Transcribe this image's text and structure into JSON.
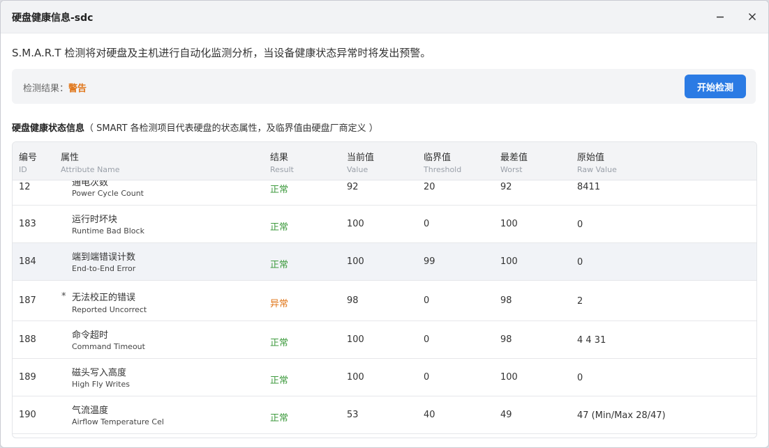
{
  "window": {
    "title": "硬盘健康信息-sdc"
  },
  "intro": "S.M.A.R.T 检测将对硬盘及主机进行自动化监测分析，当设备健康状态异常时将发出预警。",
  "result": {
    "label": "检测结果：",
    "value": "警告",
    "value_color": "#e0761a",
    "button_label": "开始检测",
    "button_color": "#2b7be4"
  },
  "section": {
    "title": "硬盘健康状态信息",
    "note": "（ SMART 各检测项目代表硬盘的状态属性，及临界值由硬盘厂商定义 ）"
  },
  "columns": [
    {
      "zh": "编号",
      "en": "ID"
    },
    {
      "zh": "属性",
      "en": "Attribute Name"
    },
    {
      "zh": "结果",
      "en": "Result"
    },
    {
      "zh": "当前值",
      "en": "Value"
    },
    {
      "zh": "临界值",
      "en": "Threshold"
    },
    {
      "zh": "最差值",
      "en": "Worst"
    },
    {
      "zh": "原始值",
      "en": "Raw Value"
    }
  ],
  "rows": [
    {
      "id": "12",
      "star": "",
      "name_zh": "通电次数",
      "name_en": "Power Cycle Count",
      "result": "正常",
      "status": "ok",
      "value": "92",
      "threshold": "20",
      "worst": "92",
      "raw": "8411"
    },
    {
      "id": "183",
      "star": "",
      "name_zh": "运行时坏块",
      "name_en": "Runtime Bad Block",
      "result": "正常",
      "status": "ok",
      "value": "100",
      "threshold": "0",
      "worst": "100",
      "raw": "0"
    },
    {
      "id": "184",
      "star": "",
      "name_zh": "端到端错误计数",
      "name_en": "End-to-End Error",
      "result": "正常",
      "status": "ok",
      "value": "100",
      "threshold": "99",
      "worst": "100",
      "raw": "0"
    },
    {
      "id": "187",
      "star": "*",
      "name_zh": "无法校正的错误",
      "name_en": "Reported Uncorrect",
      "result": "异常",
      "status": "bad",
      "value": "98",
      "threshold": "0",
      "worst": "98",
      "raw": "2"
    },
    {
      "id": "188",
      "star": "",
      "name_zh": "命令超时",
      "name_en": "Command Timeout",
      "result": "正常",
      "status": "ok",
      "value": "100",
      "threshold": "0",
      "worst": "98",
      "raw": "4 4 31"
    },
    {
      "id": "189",
      "star": "",
      "name_zh": "磁头写入高度",
      "name_en": "High Fly Writes",
      "result": "正常",
      "status": "ok",
      "value": "100",
      "threshold": "0",
      "worst": "100",
      "raw": "0"
    },
    {
      "id": "190",
      "star": "",
      "name_zh": "气流温度",
      "name_en": "Airflow Temperature Cel",
      "result": "正常",
      "status": "ok",
      "value": "53",
      "threshold": "40",
      "worst": "49",
      "raw": "47 (Min/Max 28/47)"
    }
  ]
}
